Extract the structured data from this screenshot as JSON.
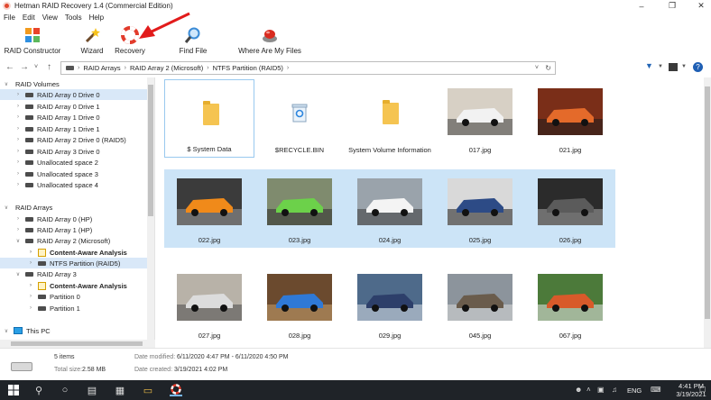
{
  "window": {
    "title": "Hetman RAID Recovery 1.4 (Commercial Edition)",
    "controls": [
      "minimize",
      "maximize",
      "close"
    ]
  },
  "menu": [
    "File",
    "Edit",
    "View",
    "Tools",
    "Help"
  ],
  "toolbar": {
    "buttons": [
      {
        "label": "RAID Constructor",
        "icon": "raid-constructor-icon"
      },
      {
        "label": "Wizard",
        "icon": "wizard-wand-icon"
      },
      {
        "label": "Recovery",
        "icon": "lifebuoy-icon"
      },
      {
        "label": "Find File",
        "icon": "magnifier-icon"
      },
      {
        "label": "Where Are My Files",
        "icon": "red-button-icon"
      }
    ]
  },
  "address": {
    "segments": [
      "RAID Arrays",
      "RAID Array 2 (Microsoft)",
      "NTFS Partition (RAID5)"
    ]
  },
  "tree": {
    "items": [
      {
        "label": "RAID Volumes",
        "level": 0,
        "type": "group",
        "expanded": true
      },
      {
        "label": "RAID Array 0 Drive 0",
        "level": 1,
        "type": "drive",
        "selected": true
      },
      {
        "label": "RAID Array 0 Drive 1",
        "level": 1,
        "type": "drive"
      },
      {
        "label": "RAID Array 1 Drive 0",
        "level": 1,
        "type": "drive"
      },
      {
        "label": "RAID Array 1 Drive 1",
        "level": 1,
        "type": "drive"
      },
      {
        "label": "RAID Array 2 Drive 0 (RAID5)",
        "level": 1,
        "type": "drive"
      },
      {
        "label": "RAID Array 3 Drive 0",
        "level": 1,
        "type": "drive"
      },
      {
        "label": "Unallocated space 2",
        "level": 1,
        "type": "drive"
      },
      {
        "label": "Unallocated space 3",
        "level": 1,
        "type": "drive"
      },
      {
        "label": "Unallocated space 4",
        "level": 1,
        "type": "drive"
      },
      {
        "label": "RAID Arrays",
        "level": 0,
        "type": "group",
        "expanded": true
      },
      {
        "label": "RAID Array 0 (HP)",
        "level": 1,
        "type": "drive"
      },
      {
        "label": "RAID Array 1 (HP)",
        "level": 1,
        "type": "drive"
      },
      {
        "label": "RAID Array 2 (Microsoft)",
        "level": 1,
        "type": "drive",
        "expanded": true
      },
      {
        "label": "Content-Aware Analysis",
        "level": 2,
        "type": "analysis",
        "bold": true
      },
      {
        "label": "NTFS Partition (RAID5)",
        "level": 2,
        "type": "drive",
        "current": true
      },
      {
        "label": "RAID Array 3",
        "level": 1,
        "type": "drive",
        "expanded": true
      },
      {
        "label": "Content-Aware Analysis",
        "level": 2,
        "type": "analysis",
        "bold": true
      },
      {
        "label": "Partition 0",
        "level": 2,
        "type": "drive"
      },
      {
        "label": "Partition 1",
        "level": 2,
        "type": "drive"
      },
      {
        "label": "This PC",
        "level": 0,
        "type": "pc",
        "expanded": true
      }
    ]
  },
  "files": [
    {
      "name": "$ System Data",
      "kind": "folder",
      "focused": true
    },
    {
      "name": "$RECYCLE.BIN",
      "kind": "recycle"
    },
    {
      "name": "System Volume Information",
      "kind": "folder"
    },
    {
      "name": "017.jpg",
      "kind": "image",
      "palette": [
        "#d7d0c5",
        "#f2f2f2",
        "#3c3c3c"
      ]
    },
    {
      "name": "021.jpg",
      "kind": "image",
      "palette": [
        "#7a2e18",
        "#e46a2a",
        "#1e1e1e"
      ]
    },
    {
      "name": "022.jpg",
      "kind": "image",
      "selected": true,
      "palette": [
        "#3b3b3b",
        "#f08a1a",
        "#9a9a9a"
      ]
    },
    {
      "name": "023.jpg",
      "kind": "image",
      "selected": true,
      "palette": [
        "#7f8b6e",
        "#6cd14a",
        "#2d2d2d"
      ]
    },
    {
      "name": "024.jpg",
      "kind": "image",
      "selected": true,
      "palette": [
        "#9aa3ab",
        "#f4f4f4",
        "#3a3a3a"
      ]
    },
    {
      "name": "025.jpg",
      "kind": "image",
      "selected": true,
      "palette": [
        "#d9d9d9",
        "#2d4b86",
        "#1b1b1b"
      ]
    },
    {
      "name": "026.jpg",
      "kind": "image",
      "selected": true,
      "palette": [
        "#2b2b2b",
        "#5b5b5b",
        "#a8a8a8"
      ]
    },
    {
      "name": "027.jpg",
      "kind": "image",
      "palette": [
        "#b8b2a8",
        "#dcdcdc",
        "#4b4b4b"
      ]
    },
    {
      "name": "028.jpg",
      "kind": "image",
      "palette": [
        "#6b4a2e",
        "#2f79d6",
        "#c8a36f"
      ]
    },
    {
      "name": "029.jpg",
      "kind": "image",
      "palette": [
        "#4e6a8a",
        "#2d3f6a",
        "#d9dfe6"
      ]
    },
    {
      "name": "045.jpg",
      "kind": "image",
      "palette": [
        "#8c949c",
        "#6a5c4c",
        "#dadada"
      ]
    },
    {
      "name": "067.jpg",
      "kind": "image",
      "palette": [
        "#4c7a3a",
        "#d85a2a",
        "#e8e8e8"
      ]
    }
  ],
  "status": {
    "count": "5 items",
    "total_label": "Total size:",
    "total_value": "2.58 MB",
    "modified_label": "Date modified:",
    "modified_value": "6/11/2020 4:47 PM - 6/11/2020 4:50 PM",
    "created_label": "Date created:",
    "created_value": "3/19/2021 4:02 PM"
  },
  "taskbar": {
    "lang": "ENG",
    "time": "4:41 PM",
    "date": "3/19/2021"
  }
}
